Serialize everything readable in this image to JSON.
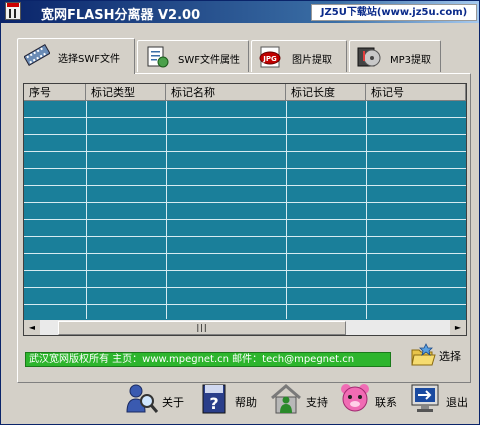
{
  "window": {
    "title": "宽网FLASH分离器 V2.00",
    "site_badge": "JZ5U下载站(www.jz5u.com)"
  },
  "tabs": [
    {
      "label": "选择SWF文件",
      "icon": "film-strip-icon"
    },
    {
      "label": "SWF文件属性",
      "icon": "document-properties-icon"
    },
    {
      "label": "图片提取",
      "icon": "jpg-image-icon"
    },
    {
      "label": "MP3提取",
      "icon": "music-disc-icon"
    }
  ],
  "table": {
    "columns": [
      "序号",
      "标记类型",
      "标记名称",
      "标记长度",
      "标记号"
    ],
    "rows": []
  },
  "footer_text": "武汉宽网版权所有 主页：www.mpegnet.cn 邮件：tech@mpegnet.cn",
  "select_button": {
    "label": "选择",
    "icon": "open-folder-icon"
  },
  "buttons": [
    {
      "label": "关于",
      "icon": "user-magnifier-icon"
    },
    {
      "label": "帮助",
      "icon": "help-book-icon"
    },
    {
      "label": "支持",
      "icon": "home-support-icon"
    },
    {
      "label": "联系",
      "icon": "pink-bear-icon"
    },
    {
      "label": "退出",
      "icon": "monitor-exit-icon"
    }
  ],
  "colors": {
    "grid_background": "#1a7f9a",
    "grid_lines": "#d6ebf1",
    "footer_bar": "#2db52d",
    "titlebar": "#0a246a"
  }
}
